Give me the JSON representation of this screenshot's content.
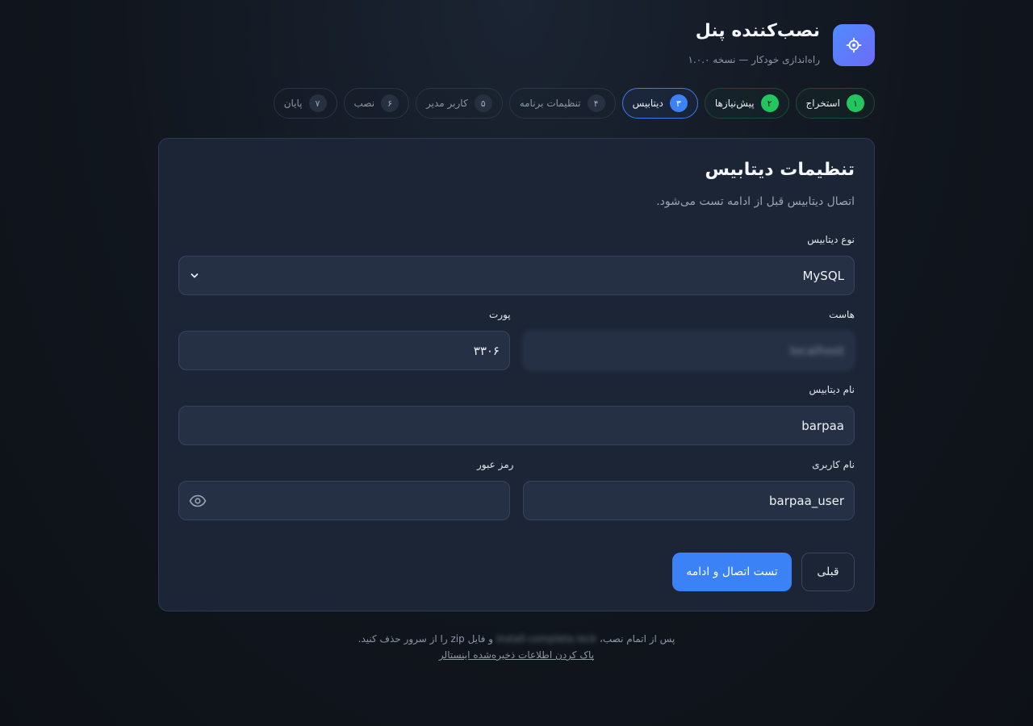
{
  "header": {
    "title": "نصب‌کننده پنل",
    "subtitle": "راه‌اندازی خودکار — نسخه ۱.۰.۰",
    "logo_icon": "gear-icon"
  },
  "steps": [
    {
      "num": "۱",
      "label": "استخراج",
      "state": "done"
    },
    {
      "num": "۲",
      "label": "پیش‌نیازها",
      "state": "done"
    },
    {
      "num": "۳",
      "label": "دیتابیس",
      "state": "active"
    },
    {
      "num": "۴",
      "label": "تنظیمات برنامه",
      "state": "pending"
    },
    {
      "num": "۵",
      "label": "کاربر مدیر",
      "state": "pending"
    },
    {
      "num": "۶",
      "label": "نصب",
      "state": "pending"
    },
    {
      "num": "۷",
      "label": "پایان",
      "state": "pending"
    }
  ],
  "card": {
    "title": "تنظیمات دیتابیس",
    "description": "اتصال دیتابیس قبل از ادامه تست می‌شود.",
    "db_type_label": "نوع دیتابیس",
    "db_type_value": "MySQL",
    "host_label": "هاست",
    "host_value": "localhost",
    "port_label": "پورت",
    "port_value": "۳۳۰۶",
    "db_name_label": "نام دیتابیس",
    "db_name_value": "barpaa",
    "username_label": "نام کاربری",
    "username_value": "barpaa_user",
    "password_label": "رمز عبور",
    "password_value": "",
    "prev_button": "قبلی",
    "next_button": "تست اتصال و ادامه"
  },
  "footer": {
    "line1_part1": "پس از اتمام نصب،",
    "line1_blurred": "install-complete.lock",
    "line1_part2": "و فایل zip را از سرور حذف کنید.",
    "clear_link": "پاک کردن اطلاعات ذخیره‌شده اینستالر"
  },
  "colors": {
    "accent": "#3b82f6",
    "success": "#22c55e",
    "card_bg": "#1c2535"
  }
}
